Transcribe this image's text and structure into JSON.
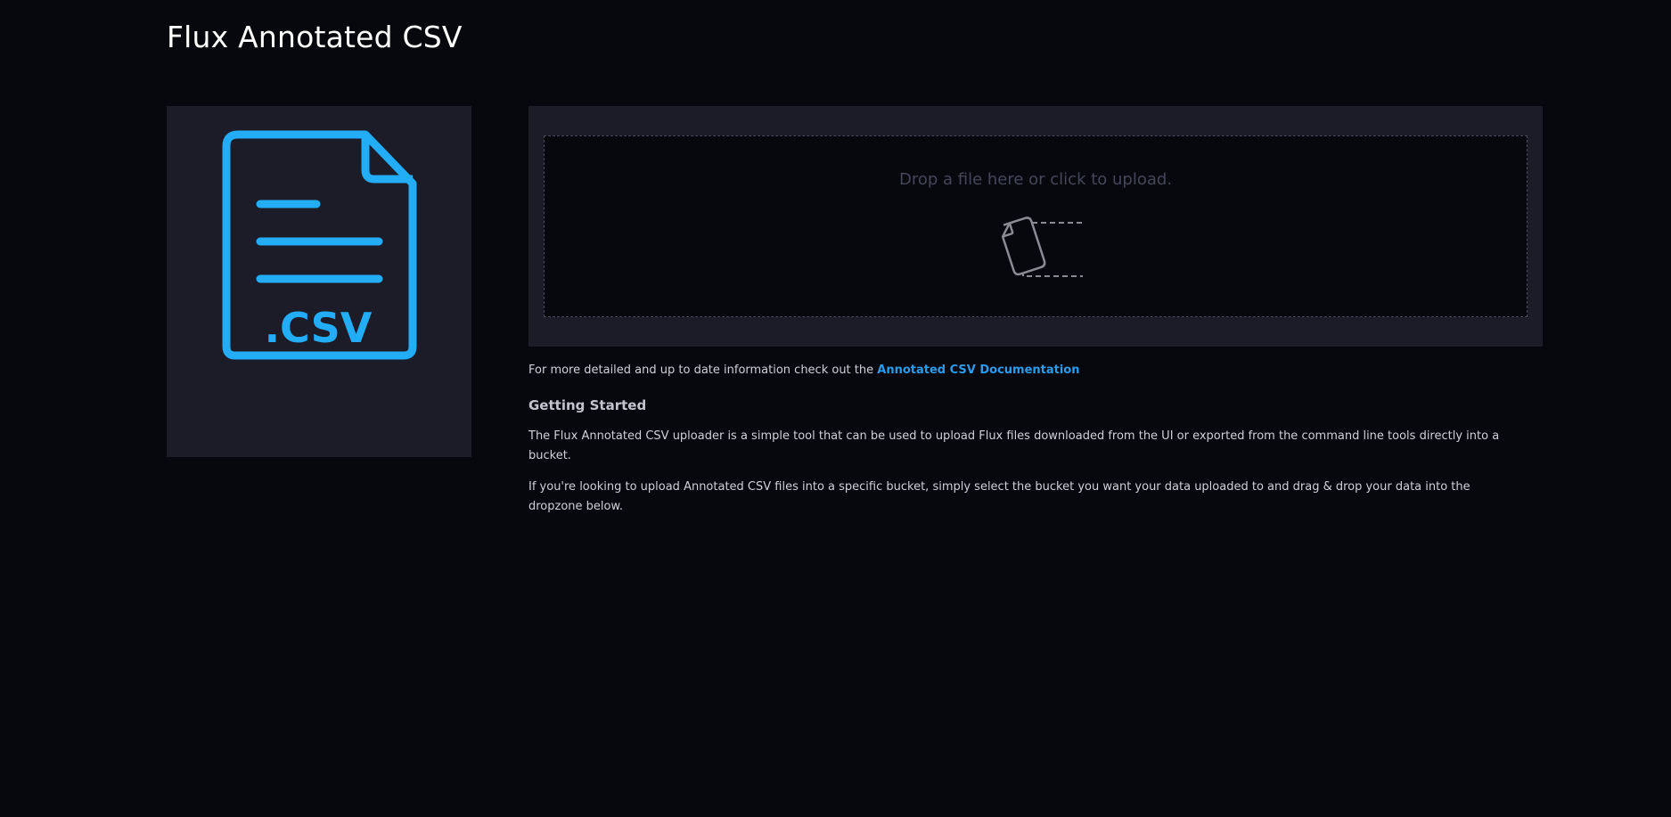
{
  "page": {
    "title": "Flux Annotated CSV"
  },
  "icon_panel": {
    "icon": "csv-file-icon",
    "extension_label": ".CSV",
    "accent_color": "#22adf6"
  },
  "dropzone": {
    "prompt": "Drop a file here or click to upload.",
    "icon": "file-upload-icon"
  },
  "content": {
    "info_prefix": "For more detailed and up to date information check out the ",
    "doc_link_label": "Annotated CSV Documentation",
    "heading": "Getting Started",
    "paragraph_1": "The Flux Annotated CSV uploader is a simple tool that can be used to upload Flux files downloaded from the UI or exported from the command line tools directly into a bucket.",
    "paragraph_2": "If you're looking to upload Annotated CSV files into a specific bucket, simply select the bucket you want your data uploaded to and drag & drop your data into the dropzone below."
  },
  "colors": {
    "background": "#07080d",
    "panel": "#1c1c29",
    "link": "#2c9bea"
  }
}
